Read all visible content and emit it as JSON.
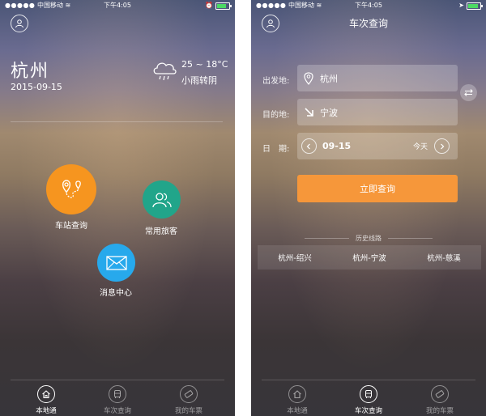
{
  "status": {
    "carrier": "中国移动",
    "time": "下午4:05"
  },
  "home": {
    "city": "杭州",
    "date": "2015-09-15",
    "weather": {
      "temp": "25 ~ 18°C",
      "desc": "小雨转阴",
      "icon": "cloud-rain-icon"
    },
    "actions": [
      {
        "label": "车站查询",
        "color": "#f6951f",
        "icon": "map-route-icon"
      },
      {
        "label": "常用旅客",
        "color": "#21a58a",
        "icon": "users-icon"
      },
      {
        "label": "消息中心",
        "color": "#27a9ec",
        "icon": "mail-icon"
      }
    ]
  },
  "query": {
    "title": "车次查询",
    "from_label": "出发地:",
    "from_value": "杭州",
    "to_label": "目的地:",
    "to_value": "宁波",
    "date_label": "日　期:",
    "date_value": "09-15",
    "date_day": "今天",
    "search_label": "立即查询",
    "history_title": "历史线路",
    "history": [
      "杭州-绍兴",
      "杭州-宁波",
      "杭州-慈溪"
    ]
  },
  "tabs": [
    "本地通",
    "车次查询",
    "我的车票"
  ],
  "colors": {
    "accent_orange": "#f6973a",
    "battery_green": "#4cd964"
  }
}
